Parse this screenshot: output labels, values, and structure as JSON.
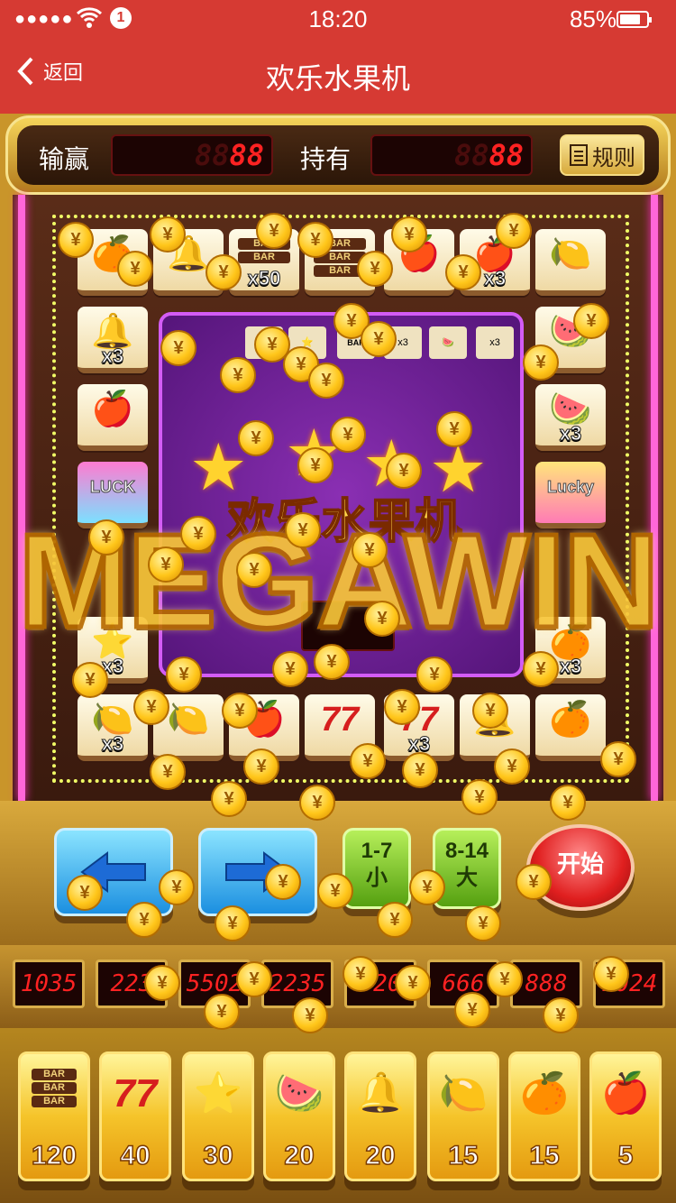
{
  "status": {
    "time": "18:20",
    "battery": "85%",
    "notification": "1"
  },
  "nav": {
    "back_label": "返回",
    "title": "欢乐水果机"
  },
  "top": {
    "win_label": "输赢",
    "hold_label": "持有",
    "win_value": "88",
    "hold_value": "88",
    "rules_label": "规则"
  },
  "tiles": [
    {
      "icon": "orange-icon",
      "glyph": "🍊",
      "mult": ""
    },
    {
      "icon": "bell-icon",
      "glyph": "🔔",
      "mult": ""
    },
    {
      "icon": "bar-icon",
      "glyph": "",
      "mult": "x50"
    },
    {
      "icon": "bar-icon",
      "glyph": "",
      "mult": ""
    },
    {
      "icon": "apple-icon",
      "glyph": "🍎",
      "mult": ""
    },
    {
      "icon": "apple-icon",
      "glyph": "🍎",
      "mult": "x3"
    },
    {
      "icon": "lemon-icon",
      "glyph": "🍋",
      "mult": ""
    },
    {
      "icon": "bell-icon",
      "glyph": "🔔",
      "mult": "x3"
    },
    {
      "icon": "watermelon-icon",
      "glyph": "🍉",
      "mult": ""
    },
    {
      "icon": "apple-icon",
      "glyph": "🍎",
      "mult": ""
    },
    {
      "icon": "watermelon-icon",
      "glyph": "🍉",
      "mult": "x3"
    },
    {
      "icon": "luck-icon",
      "glyph": "",
      "mult": ""
    },
    {
      "icon": "lucky-icon",
      "glyph": "",
      "mult": ""
    },
    {
      "icon": "star-icon",
      "glyph": "⭐",
      "mult": "x3"
    },
    {
      "icon": "orange-icon",
      "glyph": "🍊",
      "mult": "x3"
    },
    {
      "icon": "lemon-icon",
      "glyph": "🍋",
      "mult": "x3"
    },
    {
      "icon": "lemon-icon",
      "glyph": "🍋",
      "mult": ""
    },
    {
      "icon": "apple-icon",
      "glyph": "🍎",
      "mult": ""
    },
    {
      "icon": "seven-icon",
      "glyph": "77",
      "mult": ""
    },
    {
      "icon": "seven-icon",
      "glyph": "77",
      "mult": "x3"
    },
    {
      "icon": "bell-icon",
      "glyph": "🔔",
      "mult": ""
    },
    {
      "icon": "orange-icon",
      "glyph": "🍊",
      "mult": ""
    }
  ],
  "luck_text": "LUCK",
  "lucky_text": "Lucky",
  "center": {
    "title": "欢乐水果机",
    "mini_mults": [
      "x3",
      "x3"
    ]
  },
  "mega": "MEGAWIN",
  "controls": {
    "small_range": "1-7",
    "small_label": "小",
    "big_range": "8-14",
    "big_label": "大",
    "start_label": "开始"
  },
  "odds": [
    "1035",
    "223",
    "5502",
    "2235",
    "520",
    "666",
    "888",
    "1024"
  ],
  "bets": [
    {
      "icon": "bar-icon",
      "glyph": "",
      "value": "120"
    },
    {
      "icon": "seven-icon",
      "glyph": "77",
      "value": "40"
    },
    {
      "icon": "star-icon",
      "glyph": "⭐",
      "value": "30"
    },
    {
      "icon": "watermelon-icon",
      "glyph": "🍉",
      "value": "20"
    },
    {
      "icon": "bell-icon",
      "glyph": "🔔",
      "value": "20"
    },
    {
      "icon": "lemon-icon",
      "glyph": "🍋",
      "value": "15"
    },
    {
      "icon": "orange-icon",
      "glyph": "🍊",
      "value": "15"
    },
    {
      "icon": "apple-icon",
      "glyph": "🍎",
      "value": "5"
    }
  ],
  "bar_text": "BAR",
  "coin_glyph": "¥"
}
